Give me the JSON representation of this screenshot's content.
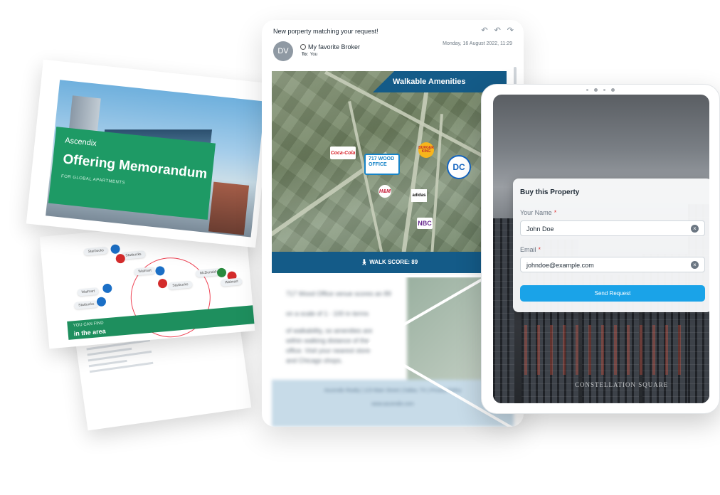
{
  "brochure": {
    "brand": "Ascendix",
    "title": "Offering Memorandum",
    "subtitle": "FOR GLOBAL APARTMENTS",
    "band_small": "YOU CAN FIND",
    "band_large": "in the area",
    "pins": [
      "Starbucks",
      "Starbucks",
      "Walmart",
      "Walmart",
      "Starbucks",
      "McDonald's",
      "Walmart",
      "Starbucks"
    ]
  },
  "email": {
    "subject": "New porperty matching your request!",
    "avatar_initials": "DV",
    "sender": "My favorite Broker",
    "to_label": "To:",
    "to_value": "You",
    "date": "Monday, 16 August 2022, 11:29",
    "map": {
      "header": "Walkable Amenities",
      "office_label": "717 WOOD OFFICE",
      "walk_score": "WALK SCORE: 89",
      "logos": {
        "coke": "Coca-Cola",
        "bk": "BURGER KING",
        "dc": "DC",
        "hm": "H&M",
        "adidas": "adidas",
        "nbc": "NBC"
      }
    },
    "blurred": {
      "line1": "717 Wood Office venue scores an 89",
      "line2": "on a scale of 1 - 100 in terms",
      "line3": "of walkability, so amenities are",
      "line4": "within walking distance of the",
      "line5": "office. Visit your nearest store",
      "line6": "and Chicago shops.",
      "footer": "Ascendix Realty | 123 Main Street | Dallas, TX | Privacy Policy",
      "footer2": "www.ascendix.com"
    }
  },
  "tablet": {
    "form": {
      "title": "Buy this Property",
      "name_label": "Your Name",
      "name_value": "John Doe",
      "email_label": "Email",
      "email_value": "johndoe@example.com",
      "required_mark": "*",
      "clear_glyph": "×",
      "submit": "Send Request"
    },
    "building_sign": "CONSTELLATION SQUARE"
  },
  "colors": {
    "brochure_green": "#1e9a65",
    "email_blue": "#145b88",
    "button_blue": "#1aa3e8",
    "required_red": "#e03b3b"
  }
}
